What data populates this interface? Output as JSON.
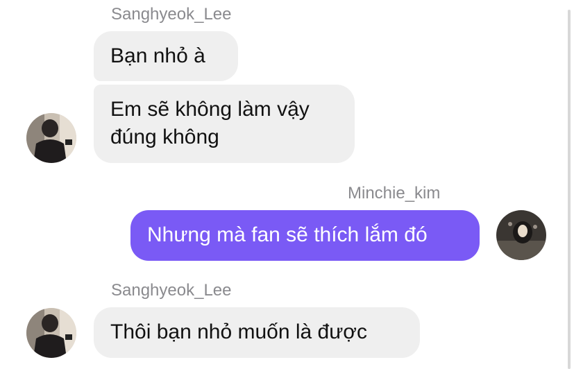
{
  "colors": {
    "incoming_bubble": "#efefef",
    "outgoing_bubble": "#7a5af5",
    "sender_name": "#8a8a8e",
    "background": "#ffffff"
  },
  "messages": [
    {
      "group": 1,
      "sender": "Sanghyeok_Lee",
      "direction": "incoming",
      "bubbles": [
        {
          "lines": [
            "Bạn nhỏ à"
          ]
        },
        {
          "lines": [
            "Em sẽ không làm vậy",
            "đúng không"
          ]
        }
      ],
      "avatar_icon": "user-photo-sanghyeok"
    },
    {
      "group": 2,
      "sender": "Minchie_kim",
      "direction": "outgoing",
      "bubbles": [
        {
          "lines": [
            "Nhưng mà fan sẽ thích lắm đó"
          ]
        }
      ],
      "avatar_icon": "user-photo-minchie"
    },
    {
      "group": 3,
      "sender": "Sanghyeok_Lee",
      "direction": "incoming",
      "bubbles": [
        {
          "lines": [
            "Thôi bạn nhỏ muốn là được"
          ]
        }
      ],
      "avatar_icon": "user-photo-sanghyeok"
    }
  ]
}
